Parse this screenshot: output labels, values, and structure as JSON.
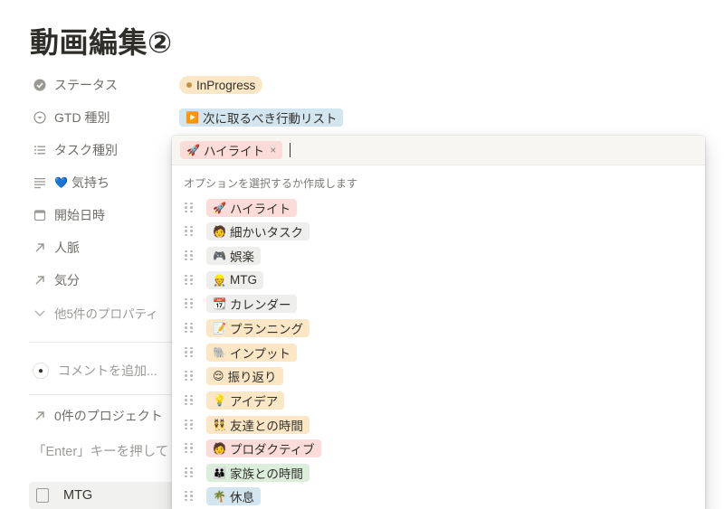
{
  "page": {
    "title": "動画編集②"
  },
  "properties": [
    {
      "icon": "check-circle-icon",
      "label": "ステータス"
    },
    {
      "icon": "select-arrow-icon",
      "label": "GTD 種別"
    },
    {
      "icon": "list-icon",
      "label": "タスク種別"
    },
    {
      "icon": "text-lines-icon",
      "emoji": "💙",
      "label": "気持ち"
    },
    {
      "icon": "calendar-icon",
      "label": "開始日時"
    },
    {
      "icon": "relation-arrow-icon",
      "label": "人脈"
    },
    {
      "icon": "relation-arrow-icon",
      "label": "気分"
    },
    {
      "icon": "chevron-down-icon",
      "label": "他5件のプロパティ"
    }
  ],
  "status": {
    "value": "InProgress",
    "color": "#fbe6c5"
  },
  "gtd": {
    "emoji": "▶️",
    "value": "次に取るべき行動リスト",
    "color": "#d3e5ef"
  },
  "comment": {
    "placeholder": "コメントを追加..."
  },
  "projects": {
    "label": "0件のプロジェクト"
  },
  "hint": {
    "text": "「Enter」キーを押して"
  },
  "bottom_item": {
    "label": "MTG"
  },
  "dropdown": {
    "selected": {
      "emoji": "🚀",
      "label": "ハイライト",
      "remove": "×",
      "color": "#fbdcd8"
    },
    "heading": "オプションを選択するか作成します",
    "options": [
      {
        "emoji": "🚀",
        "label": "ハイライト",
        "color": "#fbdcd8"
      },
      {
        "emoji": "🧑",
        "label": "細かいタスク",
        "color": "#eeeeec"
      },
      {
        "emoji": "🎮",
        "label": "娯楽",
        "color": "#eeeeec"
      },
      {
        "emoji": "👷",
        "label": "MTG",
        "color": "#eeeeec"
      },
      {
        "emoji": "📆",
        "label": "カレンダー",
        "color": "#eeeeec"
      },
      {
        "emoji": "📝",
        "label": "プランニング",
        "color": "#fbe6c5"
      },
      {
        "emoji": "🐘",
        "label": "インプット",
        "color": "#fbe6c5"
      },
      {
        "emoji": "😌",
        "label": "振り返り",
        "color": "#fbe6c5"
      },
      {
        "emoji": "💡",
        "label": "アイデア",
        "color": "#fbe6c5"
      },
      {
        "emoji": "👯",
        "label": "友達との時間",
        "color": "#fbe6c5"
      },
      {
        "emoji": "🧑",
        "label": "プロダクティブ",
        "color": "#fbdcd8"
      },
      {
        "emoji": "👪",
        "label": "家族との時間",
        "color": "#dbeddb"
      },
      {
        "emoji": "🌴",
        "label": "休息",
        "color": "#d3e5ef"
      }
    ]
  }
}
